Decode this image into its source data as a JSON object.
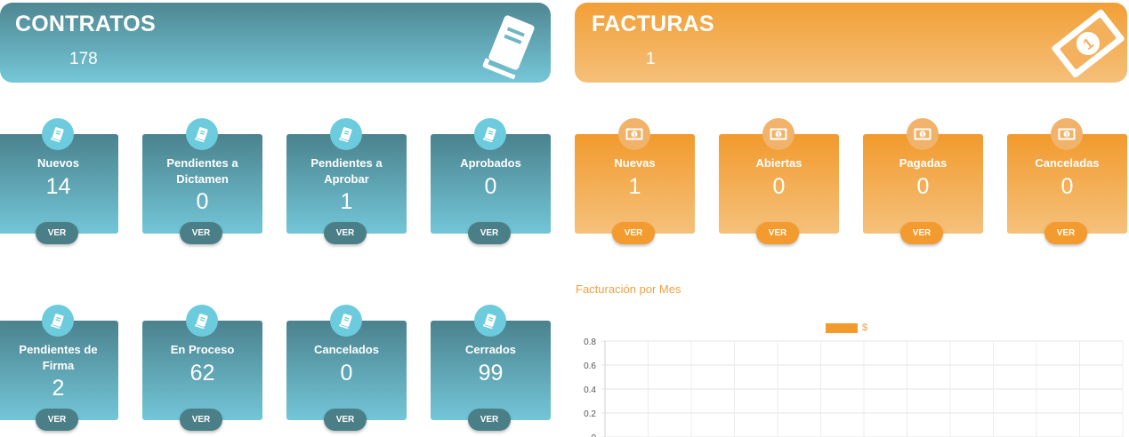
{
  "contratos": {
    "title": "CONTRATOS",
    "count": "178",
    "cards": [
      {
        "label": "Nuevos",
        "value": "14",
        "button": "VER"
      },
      {
        "label": "Pendientes a Dictamen",
        "value": "0",
        "button": "VER"
      },
      {
        "label": "Pendientes a Aprobar",
        "value": "1",
        "button": "VER"
      },
      {
        "label": "Aprobados",
        "value": "0",
        "button": "VER"
      },
      {
        "label": "Pendientes de Firma",
        "value": "2",
        "button": "VER"
      },
      {
        "label": "En Proceso",
        "value": "62",
        "button": "VER"
      },
      {
        "label": "Cancelados",
        "value": "0",
        "button": "VER"
      },
      {
        "label": "Cerrados",
        "value": "99",
        "button": "VER"
      }
    ],
    "icon": "book-icon",
    "color": "#5fa9b8"
  },
  "facturas": {
    "title": "FACTURAS",
    "count": "1",
    "cards": [
      {
        "label": "Nuevas",
        "value": "1",
        "button": "VER"
      },
      {
        "label": "Abiertas",
        "value": "0",
        "button": "VER"
      },
      {
        "label": "Pagadas",
        "value": "0",
        "button": "VER"
      },
      {
        "label": "Canceladas",
        "value": "0",
        "button": "VER"
      }
    ],
    "icon": "money-bill-icon",
    "color": "#f29f36"
  },
  "chart_data": {
    "type": "bar",
    "title": "Facturación por Mes",
    "series": [
      {
        "name": "$",
        "values": [],
        "color": "#f39a2c"
      }
    ],
    "y_ticks": [
      "0.8",
      "0.6",
      "0.4",
      "0.2",
      "0"
    ],
    "ylim": [
      0,
      1
    ],
    "grid": true,
    "legend": "top-center"
  }
}
